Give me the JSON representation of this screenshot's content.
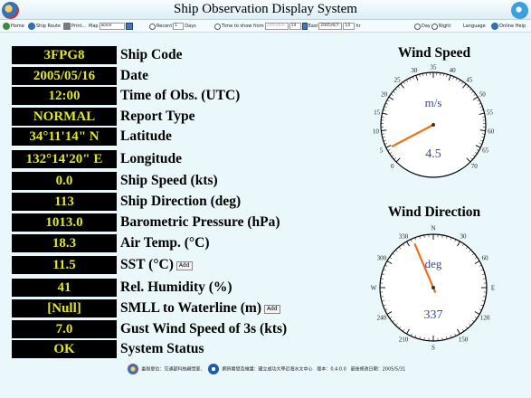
{
  "app": {
    "title": "Ship Observation Display System"
  },
  "toolbar": {
    "home": "Home",
    "ship_route": "Ship Route",
    "print": "Print...",
    "map_label": "Map",
    "map_value": "wave",
    "recent_label": "Recent",
    "recent_value": "1",
    "days": "Days",
    "time_show_label": "Time to show from",
    "from_date": "2005/6/6",
    "from_hour": "14",
    "east_label": "East",
    "to_date": "2005/6/7",
    "to_hour": "14",
    "hr": "hr",
    "day": "Day",
    "night": "Night",
    "language": "Language",
    "online_help": "Online Help"
  },
  "fields": [
    {
      "value": "3FPG8",
      "label": "Ship Code"
    },
    {
      "value": "2005/05/16",
      "label": "Date"
    },
    {
      "value": "12:00",
      "label": "Time of Obs. (UTC)"
    },
    {
      "value": "NORMAL",
      "label": "Report Type"
    },
    {
      "value": "34°11'14\" N",
      "label": "Latitude"
    },
    {
      "value": "132°14'20\" E",
      "label": "Longitude"
    },
    {
      "value": "0.0",
      "label": "Ship Speed (kts)"
    },
    {
      "value": "113",
      "label": "Ship Direction (deg)"
    },
    {
      "value": "1013.0",
      "label": "Barometric Pressure (hPa)"
    },
    {
      "value": "18.3",
      "label": "Air Temp. (°C)"
    },
    {
      "value": "11.5",
      "label": "SST (°C)",
      "add": "Add"
    },
    {
      "value": "41",
      "label": "Rel. Humidity (%)"
    },
    {
      "value": "[Null]",
      "label": "SMLL to Waterline (m)",
      "add": "Add"
    },
    {
      "value": "7.0",
      "label": "Gust Wind Speed of 3s (kts)"
    },
    {
      "value": "OK",
      "label": "System Status"
    }
  ],
  "wind_speed": {
    "title": "Wind Speed",
    "unit": "m/s",
    "value": 4.5,
    "value_text": "4.5",
    "ticks": [
      "0",
      "5",
      "10",
      "15",
      "20",
      "25",
      "30",
      "35",
      "40",
      "45",
      "50",
      "55",
      "60",
      "65",
      "70"
    ],
    "min": 0,
    "max": 70,
    "needle_color": "#e8731a"
  },
  "wind_direction": {
    "title": "Wind Direction",
    "unit": "deg",
    "value": 337,
    "value_text": "337",
    "ticks": [
      "N",
      "30",
      "60",
      "E",
      "120",
      "150",
      "S",
      "210",
      "240",
      "W",
      "300",
      "330"
    ],
    "needle_color": "#e8731a"
  },
  "footer": {
    "org": "委辦單位：交通部科技顧問室、",
    "dev": "網頁開發及維護：國立成功大學近海水文中心",
    "version": "版本：0.4.0.0",
    "updated": "最後修改日期：2005/5/31"
  }
}
